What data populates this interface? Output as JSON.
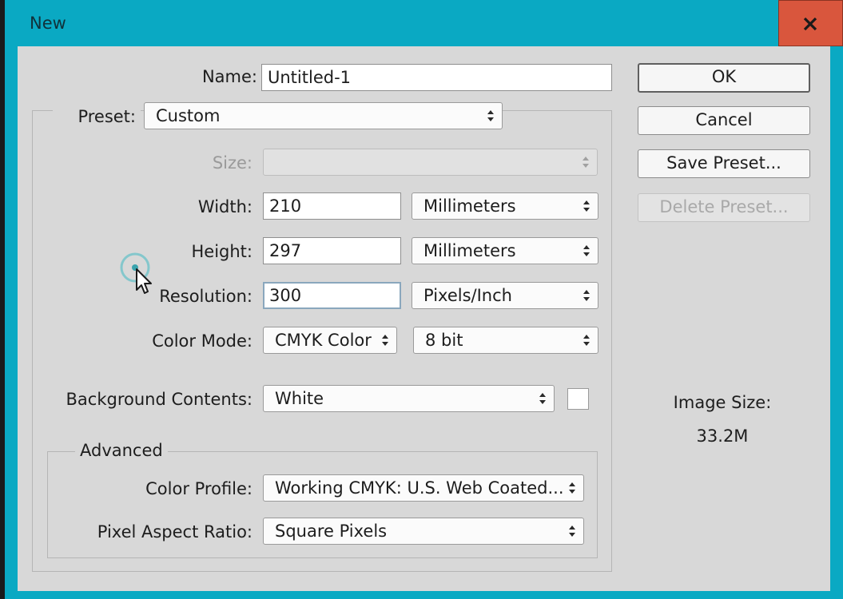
{
  "window": {
    "title": "New"
  },
  "form": {
    "name": {
      "label": "Name:",
      "value": "Untitled-1"
    },
    "preset": {
      "label": "Preset:",
      "value": "Custom"
    },
    "size": {
      "label": "Size:",
      "value": ""
    },
    "width": {
      "label": "Width:",
      "value": "210",
      "unit": "Millimeters"
    },
    "height": {
      "label": "Height:",
      "value": "297",
      "unit": "Millimeters"
    },
    "resolution": {
      "label": "Resolution:",
      "value": "300",
      "unit": "Pixels/Inch"
    },
    "color_mode": {
      "label": "Color Mode:",
      "mode": "CMYK Color",
      "depth": "8 bit"
    },
    "background": {
      "label": "Background Contents:",
      "value": "White",
      "swatch_color": "#ffffff"
    }
  },
  "advanced": {
    "title": "Advanced",
    "color_profile": {
      "label": "Color Profile:",
      "value": "Working CMYK:  U.S. Web Coated..."
    },
    "pixel_aspect": {
      "label": "Pixel Aspect Ratio:",
      "value": "Square Pixels"
    }
  },
  "buttons": {
    "ok": "OK",
    "cancel": "Cancel",
    "save_preset": "Save Preset...",
    "delete_preset": "Delete Preset..."
  },
  "image_size": {
    "label": "Image Size:",
    "value": "33.2M"
  },
  "colors": {
    "titlebar": "#0aa9c3",
    "close": "#d9563d",
    "dialog_bg": "#d8d8d8"
  }
}
